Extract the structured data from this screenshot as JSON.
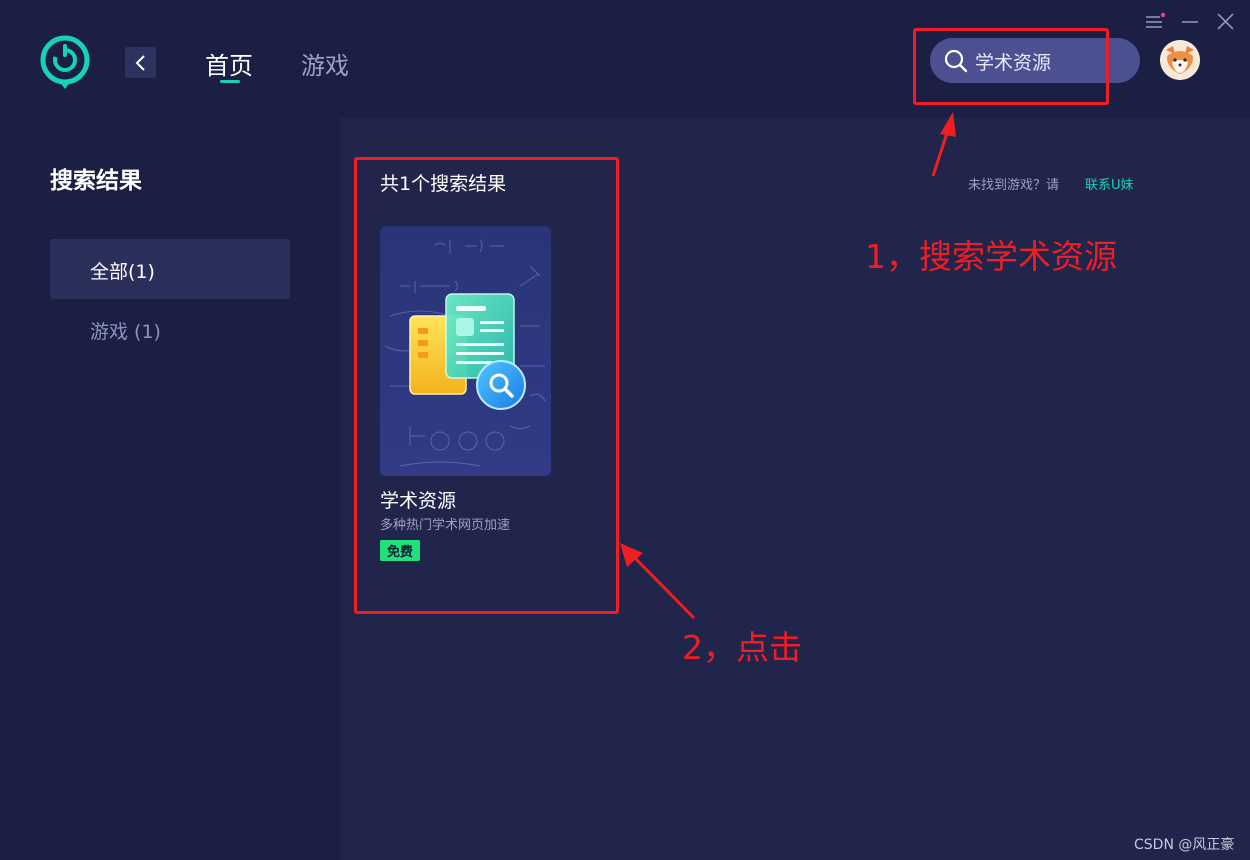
{
  "header": {
    "nav": {
      "home_label": "首页",
      "games_label": "游戏"
    },
    "search": {
      "value": "学术资源"
    },
    "colors": {
      "accent": "#19d1b4",
      "background": "#1b1f44",
      "search_bg": "#4b5090"
    }
  },
  "sidebar": {
    "title": "搜索结果",
    "items": [
      {
        "label": "全部(1)",
        "selected": true
      },
      {
        "label": "游戏 (1)",
        "selected": false
      }
    ]
  },
  "main": {
    "result_count": "共1个搜索结果",
    "not_found_text": "未找到游戏？请",
    "contact_link": "联系U妹",
    "results": [
      {
        "title": "学术资源",
        "subtitle": "多种热门学术网页加速",
        "badge": "免费"
      }
    ]
  },
  "annotations": {
    "step1": "1，搜索学术资源",
    "step2": "2，点击",
    "color": "#f01e23"
  },
  "watermark": "CSDN @风正豪"
}
